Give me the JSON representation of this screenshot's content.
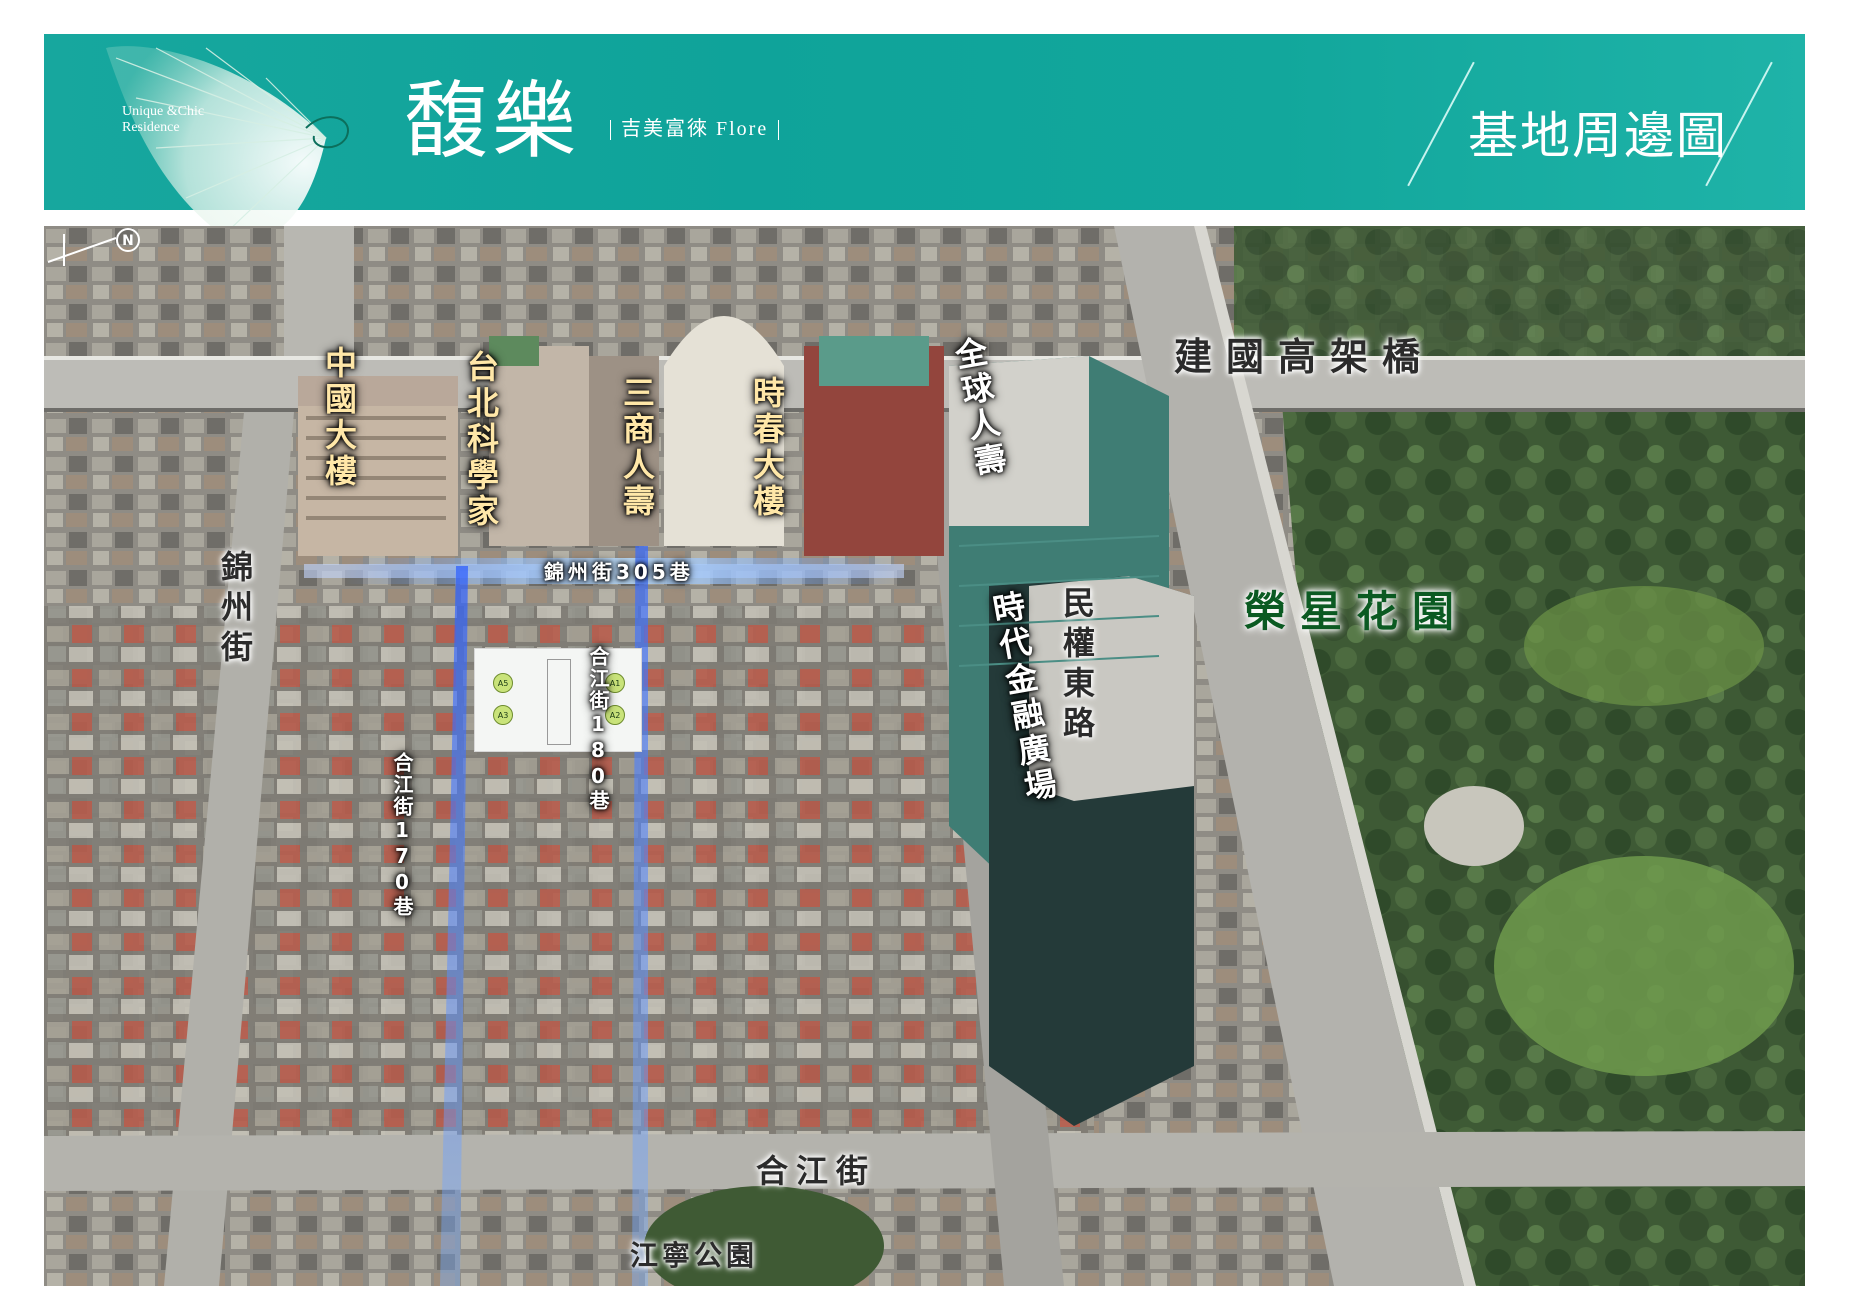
{
  "header": {
    "brand_tagline": "Unique &Chic Residence",
    "project_name": "馥樂",
    "subtitle": "吉美富徠 Flore",
    "page_title": "基地周邊圖"
  },
  "map": {
    "roads": {
      "expressway": "建國高架橋",
      "minquan_east": "民權東路",
      "jinzhou": "錦州街",
      "jinzhou_305": "錦州街305巷",
      "hejiang": "合江街",
      "hejiang_170": "合江街170巷",
      "hejiang_180": "合江街180巷"
    },
    "buildings": {
      "zhongguo": "中國大樓",
      "taibei_keji": "台北科學家",
      "sanshang": "三商人壽",
      "shichun": "時春大樓",
      "quanqiu": "全球人壽",
      "shidai": "時代金融廣場"
    },
    "parks": {
      "rongxing": "榮星花園",
      "jiangning": "江寧公園"
    },
    "site_units": [
      "A5",
      "A1",
      "A3",
      "A2"
    ],
    "compass": "N"
  },
  "colors": {
    "header_teal": "#12a79c",
    "street_glow": "#5aa6ff",
    "park_green": "#0b5a22"
  }
}
